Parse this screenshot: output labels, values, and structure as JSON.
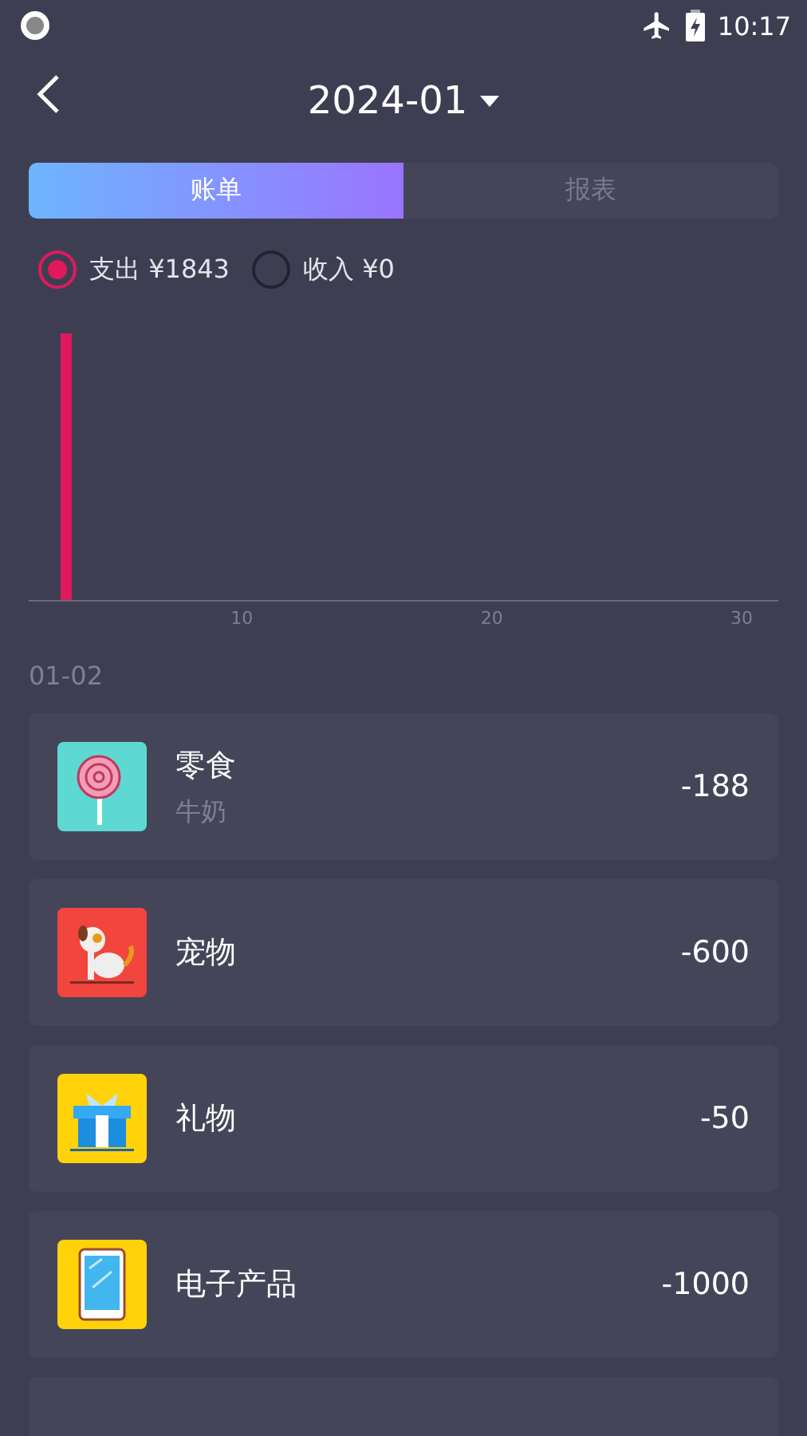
{
  "status_bar": {
    "time": "10:17"
  },
  "header": {
    "title": "2024-01"
  },
  "tabs": [
    {
      "label": "账单",
      "selected": true
    },
    {
      "label": "报表",
      "selected": false
    }
  ],
  "filters": [
    {
      "label": "支出 ¥1843",
      "selected": true
    },
    {
      "label": "收入 ¥0",
      "selected": false
    }
  ],
  "chart": {
    "x_ticks": [
      "10",
      "20",
      "30"
    ]
  },
  "date": "01-02",
  "records": [
    {
      "kind": "lollipop",
      "color": "#5ed9d1",
      "category": "零食",
      "note": "牛奶",
      "amount": "-188"
    },
    {
      "kind": "dog",
      "color": "#f2453d",
      "category": "宠物",
      "amount": "-600"
    },
    {
      "kind": "gift",
      "color": "#ffd20a",
      "category": "礼物",
      "amount": "-50"
    },
    {
      "kind": "phone",
      "color": "#ffd20a",
      "category": "电子产品",
      "amount": "-1000"
    }
  ]
}
